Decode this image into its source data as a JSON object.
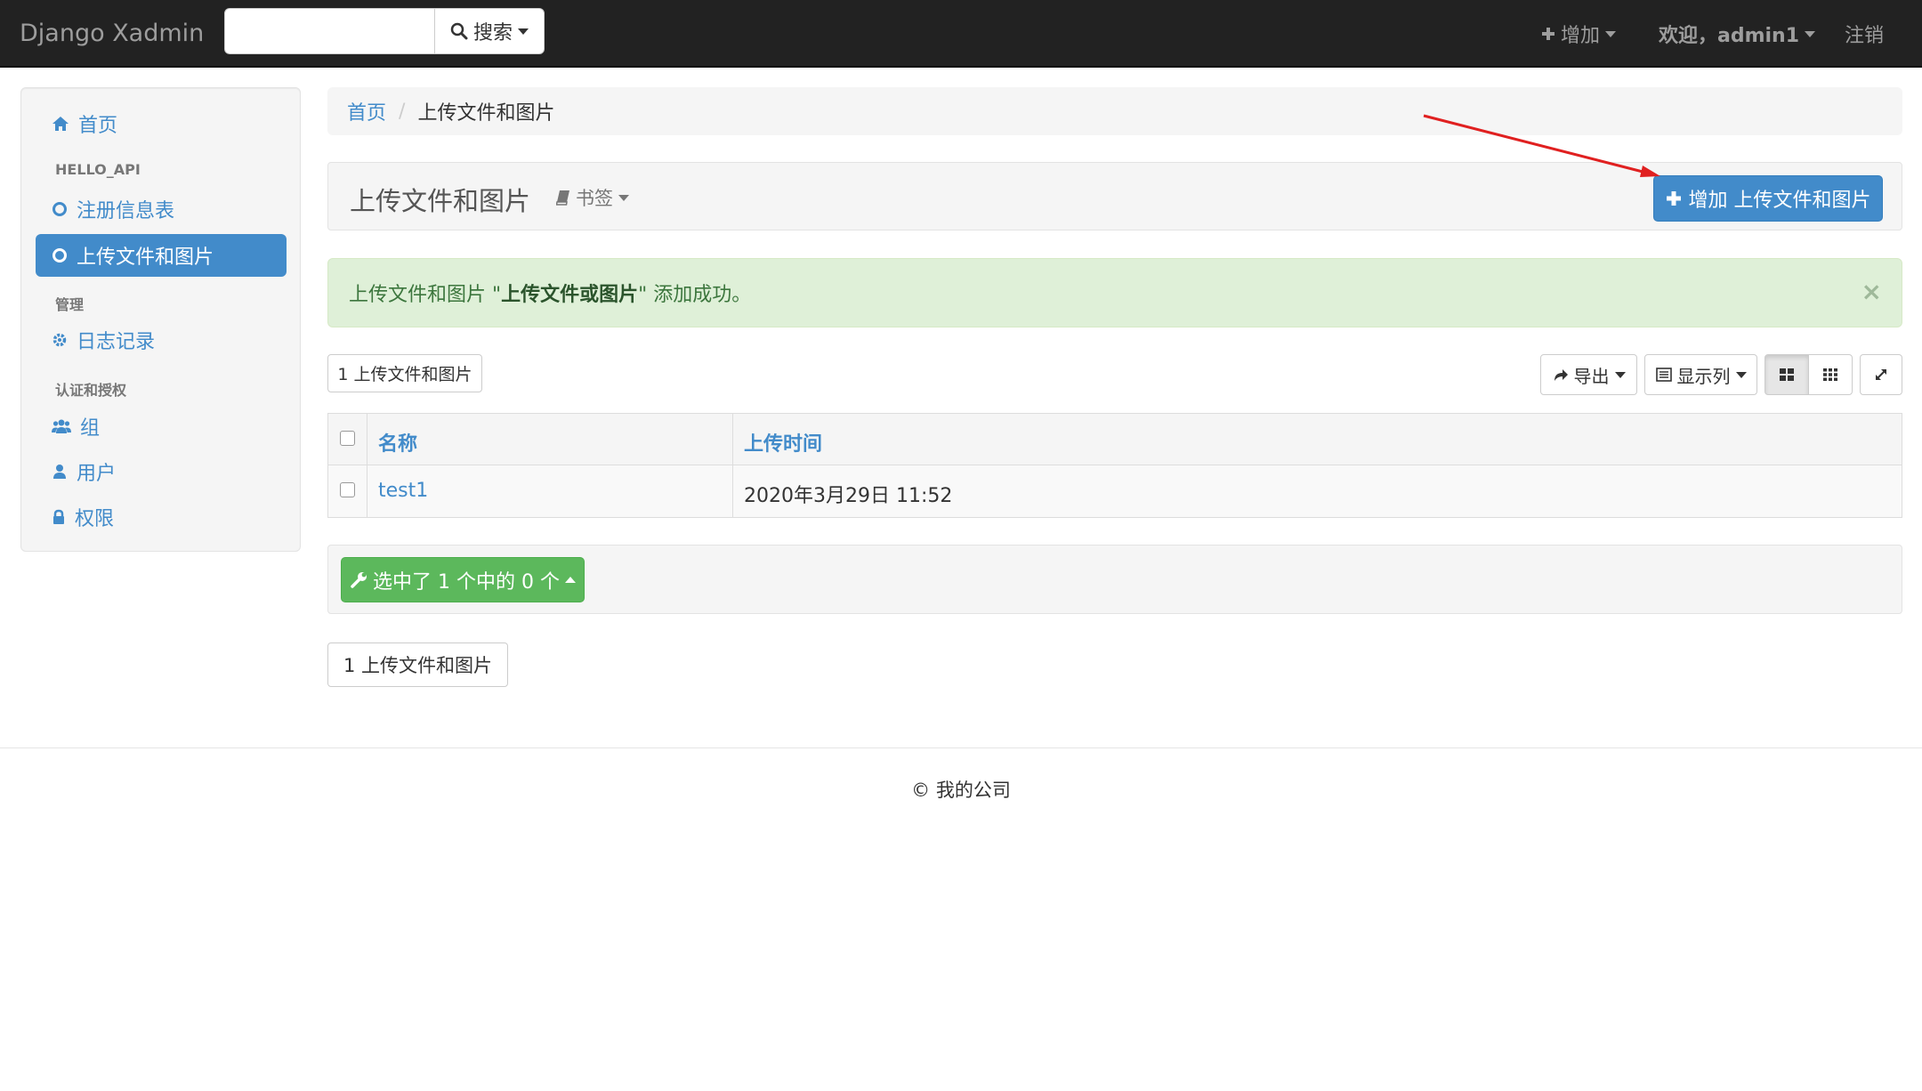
{
  "navbar": {
    "brand": "Django Xadmin",
    "search_placeholder": "",
    "search_label": "搜索",
    "add_label": "增加",
    "user_label": "欢迎，admin1",
    "logout_label": "注销",
    "background": "#222222"
  },
  "sidebar": {
    "home": "首页",
    "sections": [
      {
        "header": "HELLO_API",
        "items": [
          "注册信息表",
          "上传文件和图片"
        ]
      },
      {
        "header": "管理",
        "items": [
          "日志记录"
        ]
      },
      {
        "header": "认证和授权",
        "items": [
          "组",
          "用户",
          "权限"
        ]
      }
    ],
    "active_item": "上传文件和图片",
    "icons": [
      "home-icon",
      "circle-icon",
      "circle-icon",
      "gear-icon",
      "users-icon",
      "user-icon",
      "lock-icon"
    ]
  },
  "breadcrumb": {
    "home": "首页",
    "separator": "/",
    "current": "上传文件和图片"
  },
  "header": {
    "title": "上传文件和图片",
    "bookmark_label": "书签",
    "add_button_label": "增加 上传文件和图片"
  },
  "alert": {
    "prefix": "上传文件和图片 \"",
    "object": "上传文件或图片",
    "suffix": "\" 添加成功。",
    "close": "×"
  },
  "toolbar": {
    "count_label": "1 上传文件和图片",
    "export_label": "导出",
    "columns_label": "显示列"
  },
  "table": {
    "columns": [
      "名称",
      "上传时间"
    ],
    "rows": [
      {
        "name": "test1",
        "uploaded": "2020年3月29日 11:52"
      }
    ]
  },
  "actions": {
    "selected_label": "选中了 1 个中的 0 个"
  },
  "pagination": {
    "label": "1 上传文件和图片"
  },
  "footer": {
    "copyright": "© 我的公司"
  },
  "colors": {
    "primary": "#428bca",
    "success": "#5cb85c",
    "alert_bg": "#dff0d8",
    "annotation_arrow": "#e02020"
  }
}
